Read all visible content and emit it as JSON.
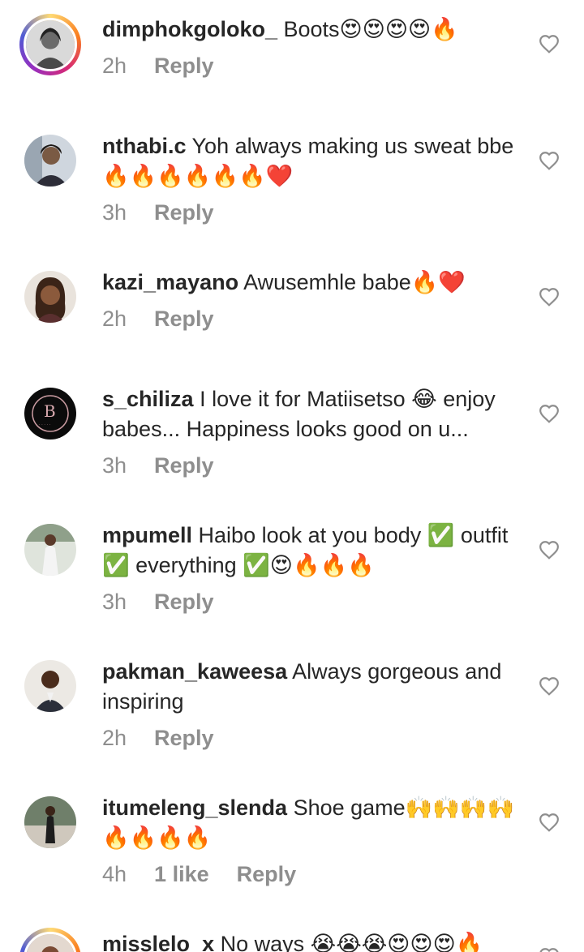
{
  "comments": [
    {
      "username": "dimphokgoloko_",
      "text": "Boots😍😍😍😍🔥",
      "time": "2h",
      "likes": "",
      "reply_label": "Reply"
    },
    {
      "username": "nthabi.c",
      "text": "Yoh always making us sweat bbe🔥🔥🔥🔥🔥🔥❤️",
      "time": "3h",
      "likes": "",
      "reply_label": "Reply"
    },
    {
      "username": "kazi_mayano",
      "text": "Awusemhle babe🔥❤️",
      "time": "2h",
      "likes": "",
      "reply_label": "Reply"
    },
    {
      "username": "s_chiliza",
      "text": "I love it for Matiisetso 😂 enjoy babes... Happiness looks good on u...",
      "time": "3h",
      "likes": "",
      "reply_label": "Reply"
    },
    {
      "username": "mpumell",
      "text": "Haibo look at you body ✅ outfit ✅ everything ✅😍🔥🔥🔥",
      "time": "3h",
      "likes": "",
      "reply_label": "Reply"
    },
    {
      "username": "pakman_kaweesa",
      "text": "Always gorgeous and inspiring",
      "time": "2h",
      "likes": "",
      "reply_label": "Reply"
    },
    {
      "username": "itumeleng_slenda",
      "text": "Shoe game🙌🙌🙌🙌🔥🔥🔥🔥",
      "time": "4h",
      "likes": "1 like",
      "reply_label": "Reply"
    },
    {
      "username": "misslelo_x",
      "text": "No ways 😭😭😭😍😍😍🔥",
      "time": "",
      "likes": "",
      "reply_label": ""
    }
  ],
  "icons": {
    "like": "heart-outline-icon"
  },
  "colors": {
    "text": "#262626",
    "meta": "#8e8e8e",
    "heart": "#8e8e8e"
  }
}
